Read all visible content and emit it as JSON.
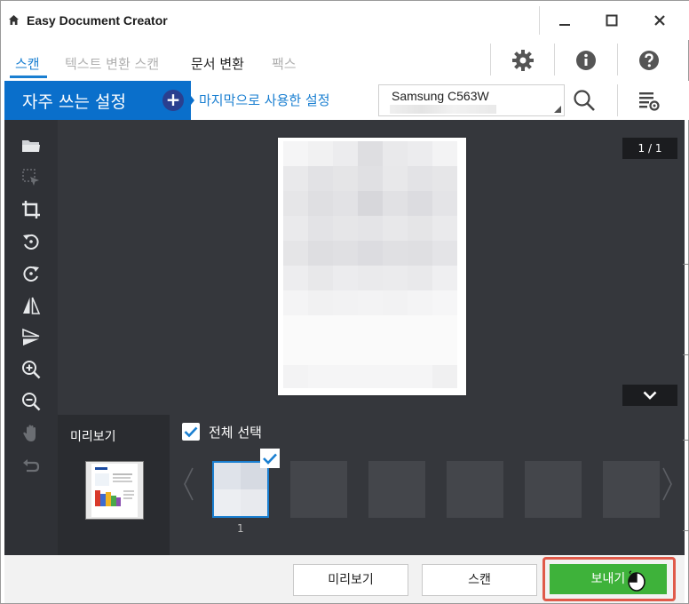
{
  "window": {
    "title": "Easy Document Creator",
    "controls": {
      "minimize": "minimize",
      "maximize": "maximize",
      "close": "close"
    }
  },
  "tabs": [
    {
      "label": "스캔",
      "state": "active"
    },
    {
      "label": "텍스트 변환 스캔",
      "state": "disabled"
    },
    {
      "label": "문서 변환",
      "state": "normal"
    },
    {
      "label": "팩스",
      "state": "disabled"
    }
  ],
  "toolbar_icons": [
    "gear-icon",
    "info-icon",
    "help-icon"
  ],
  "favorites": {
    "title": "자주 쓰는 설정",
    "last_used_label": "마지막으로 사용한 설정"
  },
  "device": {
    "selected": "Samsung C563W"
  },
  "left_tools": [
    "open-folder-icon",
    "select-area-icon",
    "crop-icon",
    "rotate-left-icon",
    "rotate-right-icon",
    "flip-vertical-icon",
    "flip-horizontal-icon",
    "zoom-in-icon",
    "zoom-out-icon",
    "pan-hand-icon",
    "undo-icon"
  ],
  "preview": {
    "page_counter": "1 / 1"
  },
  "thumbnails": {
    "preview_label": "미리보기",
    "select_all_label": "전체 선택",
    "select_all_checked": true,
    "items": [
      {
        "number": "1",
        "selected": true
      }
    ]
  },
  "bottom_buttons": {
    "preview": "미리보기",
    "scan": "스캔",
    "send": "보내기"
  },
  "colors": {
    "accent": "#1a7fd1",
    "favorites_bg": "#0a6fcb",
    "send_green": "#3eb23a",
    "highlight_red": "#e05a4a",
    "dark_panel": "#35373c"
  }
}
